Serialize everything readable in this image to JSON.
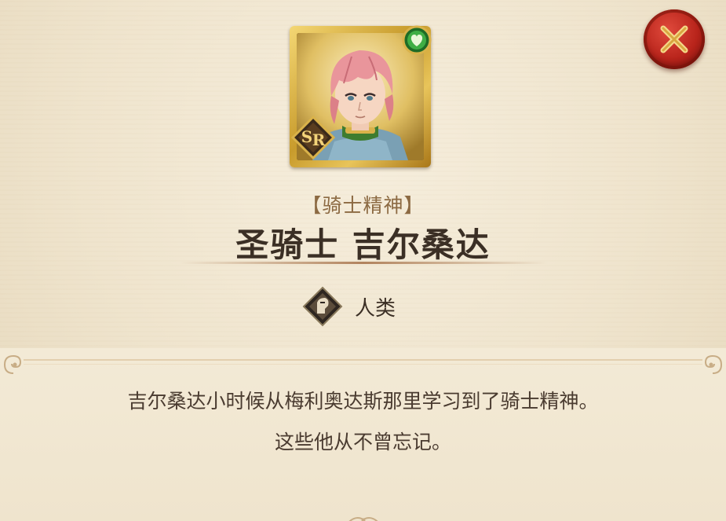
{
  "character": {
    "epithet": "【骑士精神】",
    "name": "圣骑士 吉尔桑达",
    "rarity": "SR",
    "attribute_icon": "heart-attribute-icon",
    "race_icon": "human-race-icon",
    "race": "人类"
  },
  "description": {
    "line1": "吉尔桑达小时候从梅利奥达斯那里学习到了骑士精神。",
    "line2": "这些他从不曾忘记。"
  },
  "controls": {
    "close_icon": "close-icon"
  },
  "colors": {
    "close_button": "#b8241b",
    "frame_gold": "#c89b2c",
    "attribute_green": "#2f9a3c",
    "title_text": "#3b2f25",
    "subtitle_text": "#8c6a43"
  }
}
